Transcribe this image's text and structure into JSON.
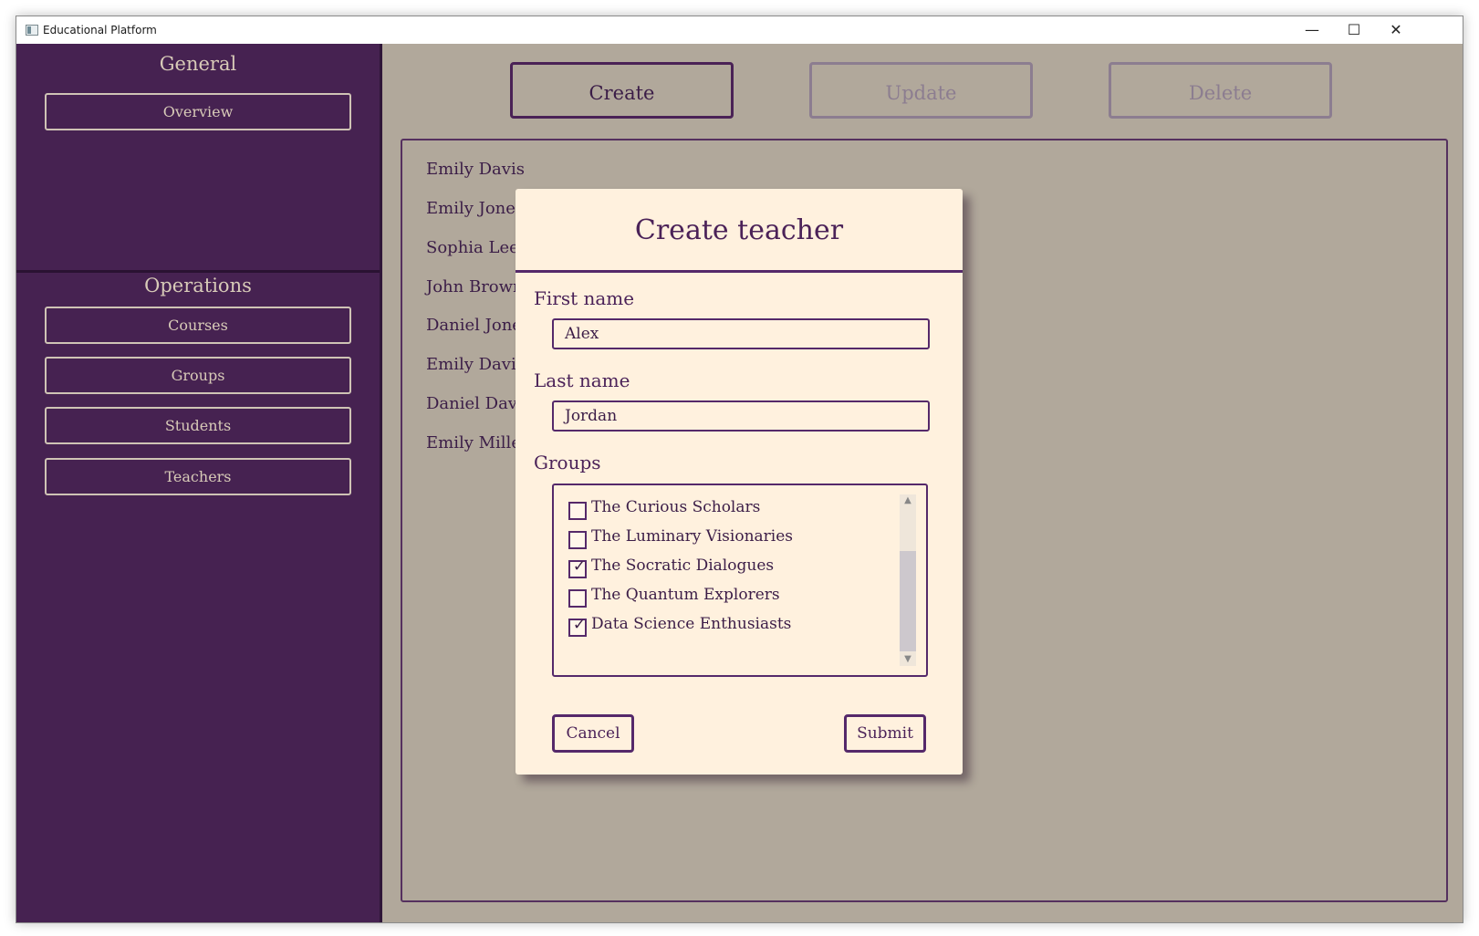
{
  "window": {
    "title": "Educational Platform",
    "controls": [
      "—",
      "☐",
      "✕"
    ]
  },
  "sidebar": {
    "general_title": "General",
    "general_items": [
      {
        "label": "Overview"
      }
    ],
    "operations_title": "Operations",
    "operations_items": [
      {
        "label": "Courses"
      },
      {
        "label": "Groups"
      },
      {
        "label": "Students"
      },
      {
        "label": "Teachers"
      }
    ]
  },
  "toolbar": {
    "create": "Create",
    "update": "Update",
    "delete": "Delete"
  },
  "teachers_list": [
    "Emily Davis",
    "Emily Jones",
    "Sophia Lee",
    "John Brown",
    "Daniel Jones",
    "Emily Davis",
    "Daniel Davis",
    "Emily Miller"
  ],
  "dialog": {
    "title": "Create teacher",
    "first_name_label": "First name",
    "first_name_value": "Alex",
    "last_name_label": "Last name",
    "last_name_value": "Jordan",
    "groups_label": "Groups",
    "groups": [
      {
        "name": "The Curious Scholars",
        "checked": false,
        "mark": ""
      },
      {
        "name": "The Luminary Visionaries",
        "checked": false,
        "mark": ""
      },
      {
        "name": "The Socratic Dialogues",
        "checked": true,
        "mark": "✓"
      },
      {
        "name": "The Quantum Explorers",
        "checked": false,
        "mark": ""
      },
      {
        "name": "Data Science Enthusiasts",
        "checked": true,
        "mark": "✓"
      }
    ],
    "cancel": "Cancel",
    "submit": "Submit"
  }
}
